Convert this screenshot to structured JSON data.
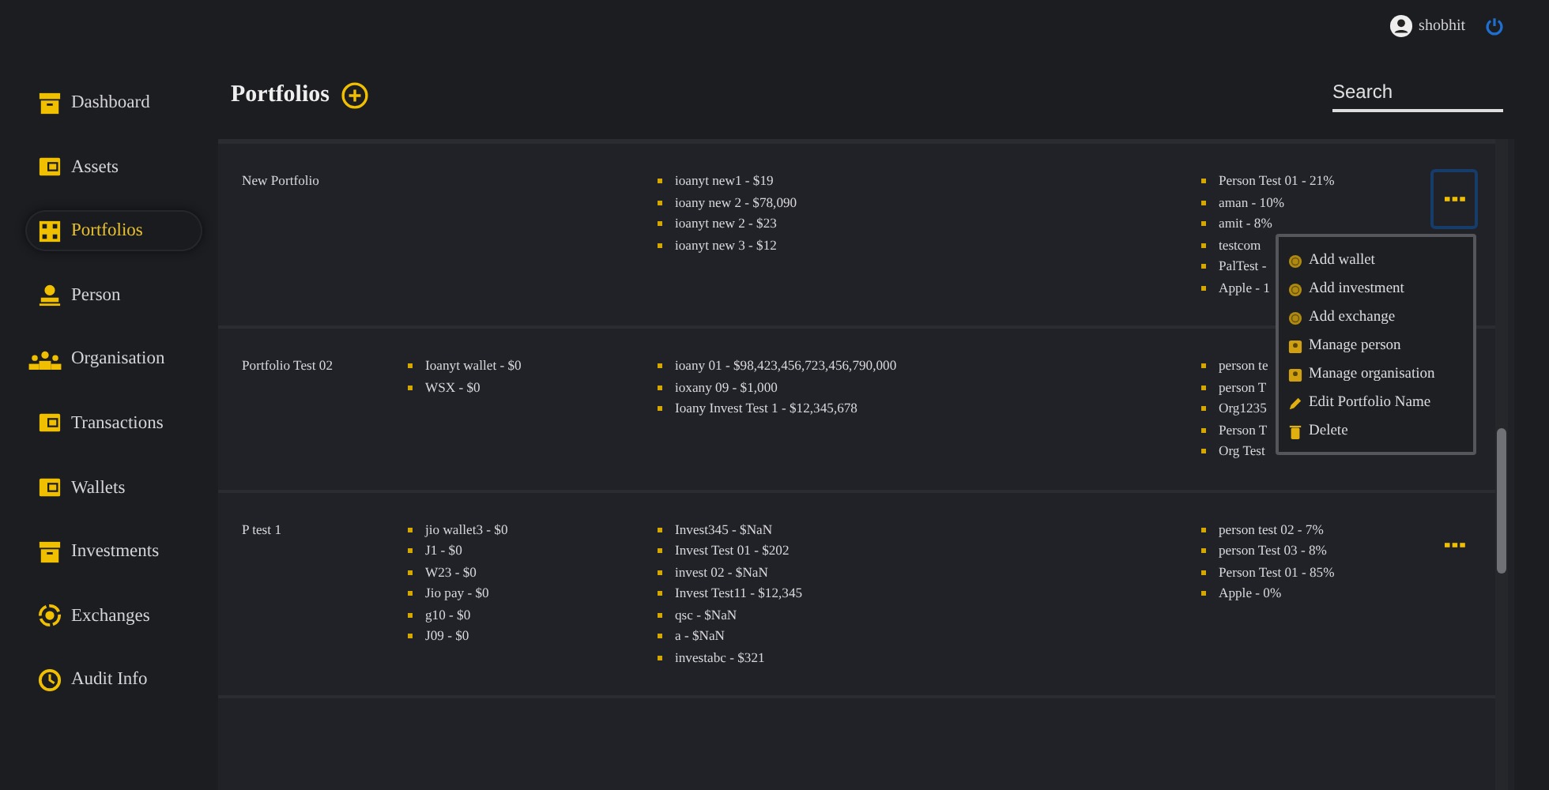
{
  "user": {
    "name": "shobhit"
  },
  "sidebar": {
    "items": [
      {
        "label": "Dashboard",
        "selected": false
      },
      {
        "label": "Assets",
        "selected": false
      },
      {
        "label": "Portfolios",
        "selected": true
      },
      {
        "label": "Person",
        "selected": false
      },
      {
        "label": "Organisation",
        "selected": false
      },
      {
        "label": "Transactions",
        "selected": false
      },
      {
        "label": "Wallets",
        "selected": false
      },
      {
        "label": "Investments",
        "selected": false
      },
      {
        "label": "Exchanges",
        "selected": false
      },
      {
        "label": "Audit Info",
        "selected": false
      }
    ]
  },
  "header": {
    "title": "Portfolios",
    "search": {
      "placeholder": "Search"
    }
  },
  "portfolios": [
    {
      "name": "New Portfolio",
      "investments": [
        "ioanyt new1 - $19",
        "ioany new 2 - $78,090",
        "ioanyt new 2 - $23",
        "ioanyt new 3 - $12"
      ],
      "persons": [
        "Person Test 01 - 21%",
        "aman - 10%",
        "amit - 8%",
        "testcom",
        "PalTest -",
        "Apple - 1"
      ],
      "menu_open": true,
      "focused": true
    },
    {
      "name": "Portfolio Test 02",
      "wallets": [
        "Ioanyt wallet - $0",
        "WSX - $0"
      ],
      "investments": [
        "ioany 01 - $98,423,456,723,456,790,000",
        "ioxany 09 - $1,000",
        "Ioany Invest Test 1 - $12,345,678"
      ],
      "persons": [
        "person te",
        "person T",
        "Org1235",
        "Person T",
        "Org Test"
      ],
      "menu_open": false
    },
    {
      "name": "P test 1",
      "wallets": [
        "jio wallet3 - $0",
        "J1 - $0",
        "W23 - $0",
        "Jio pay - $0",
        "g10 - $0",
        "J09 - $0"
      ],
      "investments": [
        "Invest345 - $NaN",
        "Invest Test 01 - $202",
        "invest 02 - $NaN",
        "Invest Test11 - $12,345",
        "qsc - $NaN",
        "a - $NaN",
        "investabc - $321"
      ],
      "persons": [
        "person test 02 - 7%",
        "person Test 03 - 8%",
        "Person Test 01 - 85%",
        "Apple - 0%"
      ],
      "menu_open": false,
      "focused": false
    }
  ],
  "menu": {
    "items": [
      "Add wallet",
      "Add investment",
      "Add exchange",
      "Manage person",
      "Manage organisation",
      "Edit Portfolio Name",
      "Delete"
    ]
  }
}
